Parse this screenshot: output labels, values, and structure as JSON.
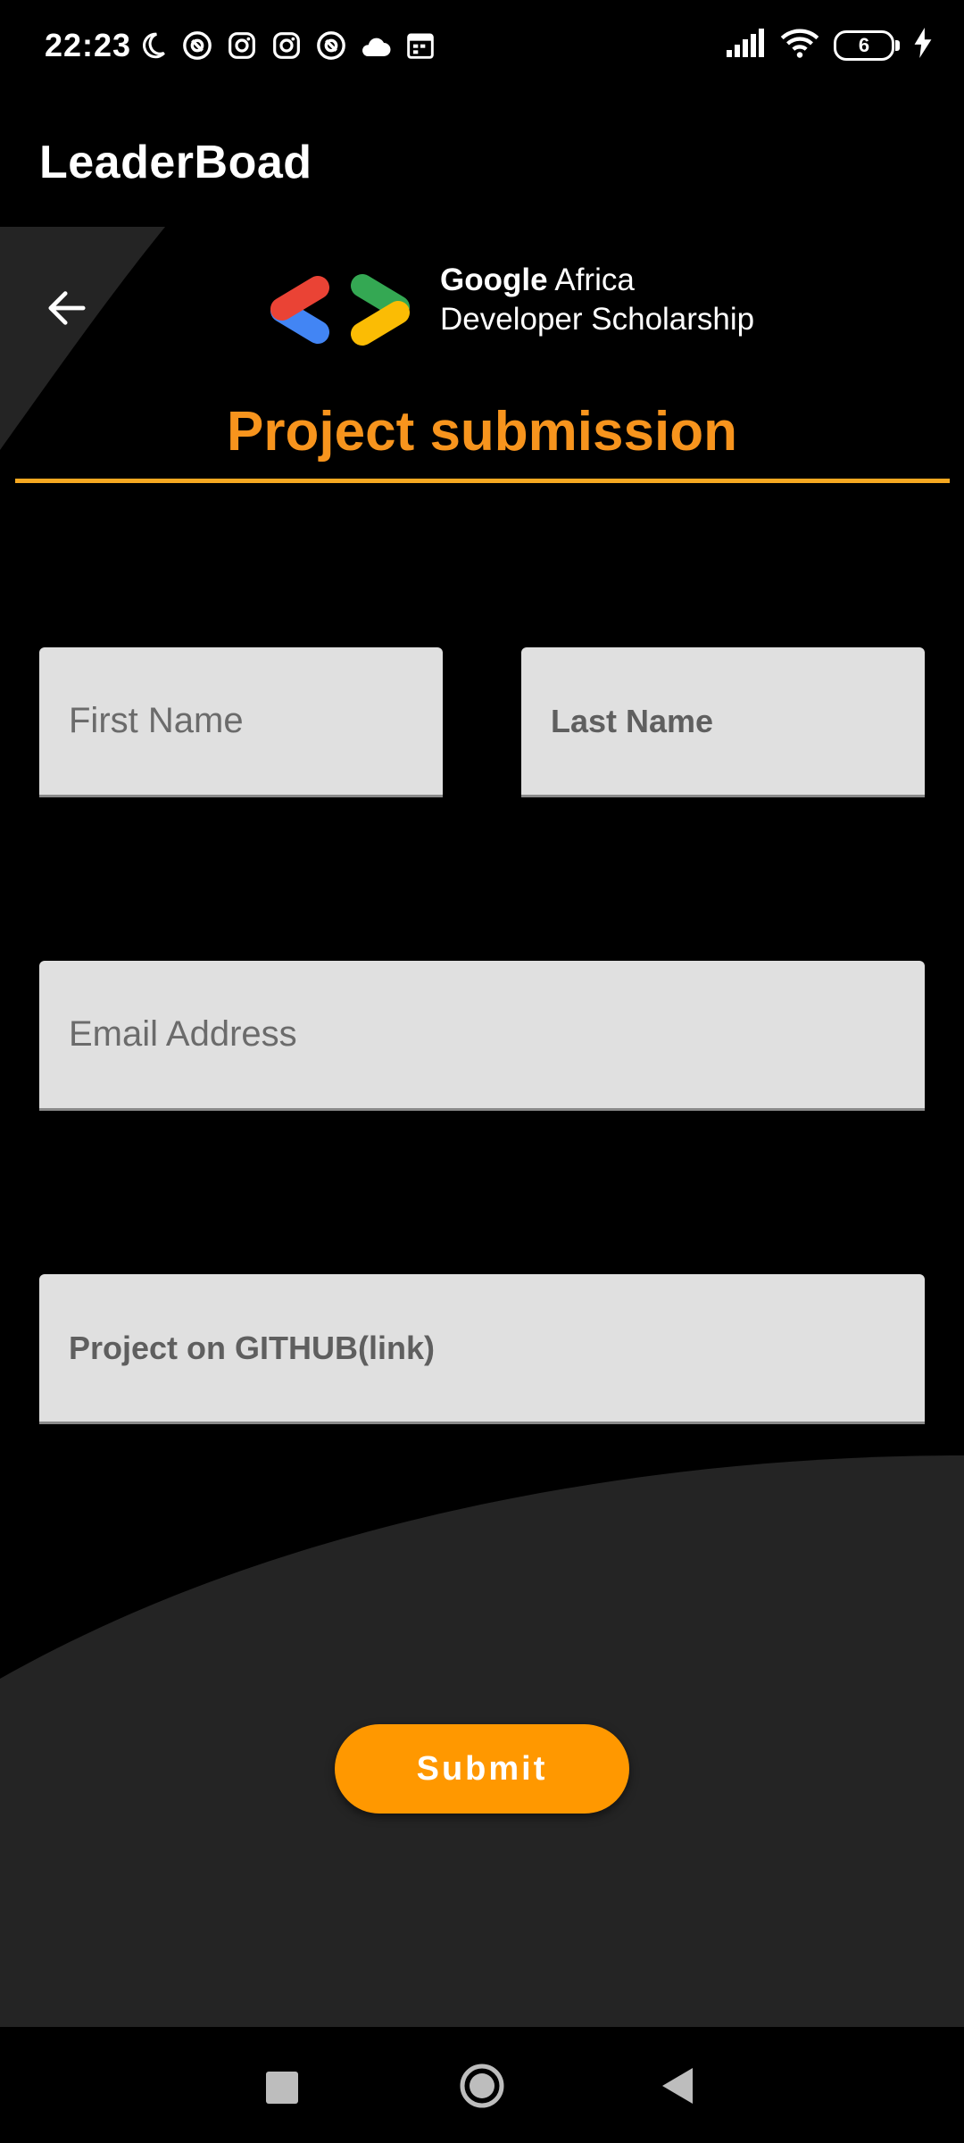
{
  "status_bar": {
    "time": "22:23",
    "battery_level": "6",
    "icons": [
      "moon-icon",
      "at-sign-icon",
      "instagram-icon",
      "instagram-icon",
      "at-sign-icon",
      "cloud-icon",
      "calendar-icon",
      "signal-icon",
      "wifi-icon",
      "battery-icon",
      "charging-icon"
    ]
  },
  "app_bar": {
    "title": "LeaderBoad"
  },
  "header": {
    "logo_line1_bold": "Google",
    "logo_line1_rest": " Africa",
    "logo_line2": "Developer Scholarship",
    "page_title": "Project submission"
  },
  "form": {
    "first_name": {
      "placeholder": "First Name",
      "value": ""
    },
    "last_name": {
      "placeholder": "Last Name",
      "value": ""
    },
    "email": {
      "placeholder": "Email Address",
      "value": ""
    },
    "github": {
      "placeholder": "Project on GITHUB(link)",
      "value": ""
    },
    "submit_label": "Submit"
  },
  "colors": {
    "accent": "#ff9800",
    "title": "#f7941d",
    "divider": "#f6a821",
    "field_bg": "#e0e0e0",
    "panel": "#242424"
  }
}
